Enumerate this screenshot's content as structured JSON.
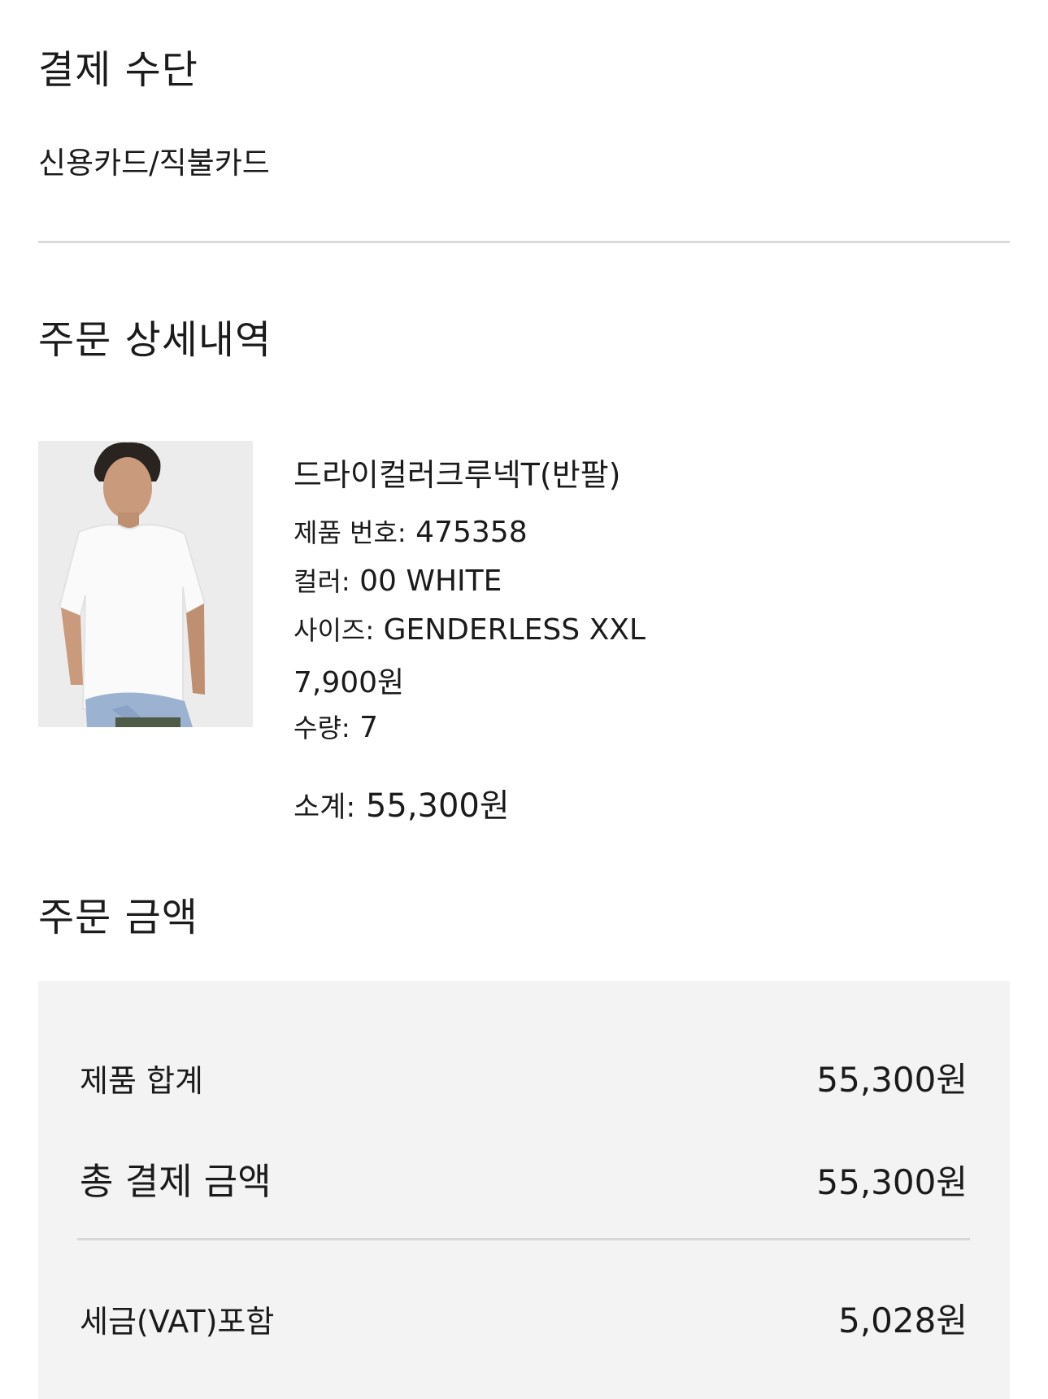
{
  "payment": {
    "title": "결제 수단",
    "method": "신용카드/직불카드"
  },
  "order_detail": {
    "title": "주문 상세내역",
    "product": {
      "image_alt": "흰색 반팔 티셔츠를 입은 모델",
      "name": "드라이컬러크루넥T(반팔)",
      "number_label": "제품 번호:",
      "number": "475358",
      "color_label": "컬러:",
      "color": "00 WHITE",
      "size_label": "사이즈:",
      "size": "GENDERLESS XXL",
      "price": "7,900원",
      "qty_label": "수량:",
      "qty": "7",
      "subtotal_label": "소계:",
      "subtotal": "55,300원"
    }
  },
  "order_amount": {
    "title": "주문 금액",
    "product_total_label": "제품 합계",
    "product_total": "55,300원",
    "grand_total_label": "총 결제 금액",
    "grand_total": "55,300원",
    "tax_label": "세금(VAT)포함",
    "tax": "5,028원"
  },
  "colors": {
    "text": "#1b1b1b",
    "divider": "#dcdcdc",
    "summary_bg": "#f3f3f3"
  }
}
